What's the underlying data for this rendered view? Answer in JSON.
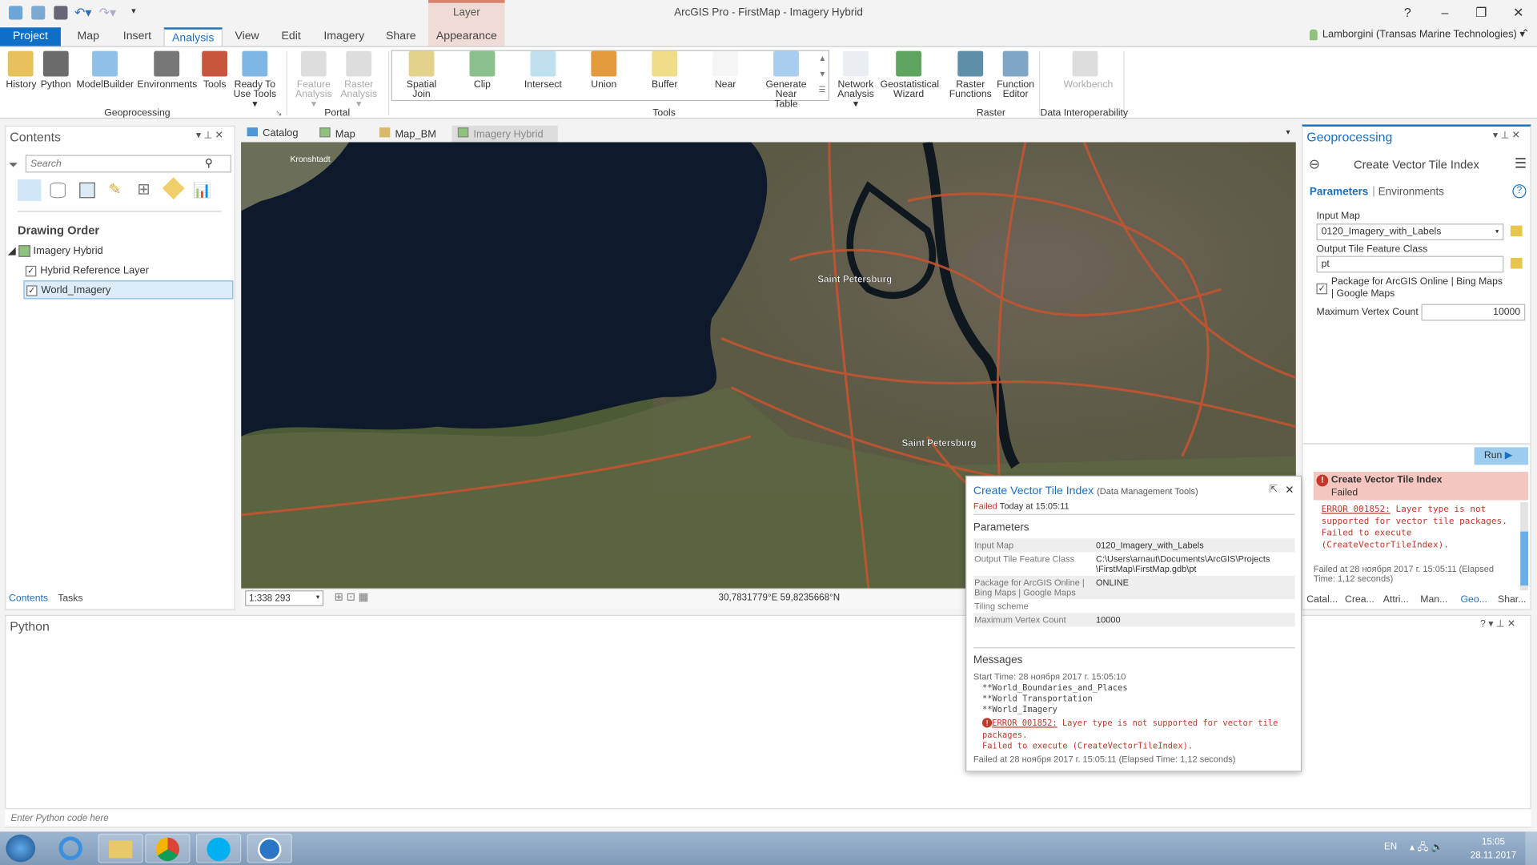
{
  "app": {
    "title": "ArcGIS Pro - FirstMap - Imagery Hybrid",
    "help": "?",
    "contextual_group": "Layer",
    "user": "Lamborgini (Transas Marine Technologies)"
  },
  "tabs": [
    "Project",
    "Map",
    "Insert",
    "Analysis",
    "View",
    "Edit",
    "Imagery",
    "Share",
    "Appearance"
  ],
  "ribbon": {
    "buttons": [
      {
        "label": "History",
        "color": "#e7c15a"
      },
      {
        "label": "Python",
        "color": "#6b6b6b"
      },
      {
        "label": "ModelBuilder",
        "color": "#8fc1e8"
      },
      {
        "label": "Environments",
        "color": "#777"
      },
      {
        "label": "Tools",
        "color": "#c8553d"
      },
      {
        "label": "Ready To\nUse Tools ▾",
        "color": "#7fb6e3"
      },
      {
        "label": "Feature\nAnalysis ▾",
        "color": "#ddd",
        "disabled": true
      },
      {
        "label": "Raster\nAnalysis ▾",
        "color": "#ddd",
        "disabled": true
      },
      {
        "label": "Spatial\nJoin",
        "color": "#e3d38a"
      },
      {
        "label": "Clip",
        "color": "#8bbf8b"
      },
      {
        "label": "Intersect",
        "color": "#bfe0ef"
      },
      {
        "label": "Union",
        "color": "#e39a3d"
      },
      {
        "label": "Buffer",
        "color": "#f0dd8a"
      },
      {
        "label": "Near",
        "color": "#f5f5f5"
      },
      {
        "label": "Generate\nNear Table",
        "color": "#a9cdef"
      },
      {
        "label": "Network\nAnalysis ▾",
        "color": "#e9eef3"
      },
      {
        "label": "Geostatistical\nWizard",
        "color": "#5ea35e"
      },
      {
        "label": "Raster\nFunctions",
        "color": "#5f8fa8"
      },
      {
        "label": "Function\nEditor",
        "color": "#7ea7c5"
      },
      {
        "label": "Workbench",
        "color": "#ddd",
        "disabled": true
      }
    ],
    "groups": [
      "Geoprocessing",
      "Portal",
      "Tools",
      "Raster",
      "Data Interoperability"
    ]
  },
  "contents": {
    "title": "Contents",
    "search_placeholder": "Search",
    "section": "Drawing Order",
    "map": "Imagery Hybrid",
    "layers": [
      {
        "name": "Hybrid Reference Layer",
        "checked": true
      },
      {
        "name": "World_Imagery",
        "checked": true,
        "selected": true
      }
    ],
    "bottom_tabs": [
      "Contents",
      "Tasks"
    ]
  },
  "view_tabs": [
    {
      "label": "Catalog"
    },
    {
      "label": "Map"
    },
    {
      "label": "Map_BM"
    },
    {
      "label": "Imagery Hybrid",
      "active": true
    }
  ],
  "map": {
    "labels": [
      "Kronshtadt",
      "Saint Petersburg",
      "Saint Petersburg"
    ],
    "scale": "1:338 293",
    "coordinates": "30,7831779°E 59,8235668°N"
  },
  "geoprocessing": {
    "title": "Geoprocessing",
    "tool": "Create Vector Tile Index",
    "tab_params": "Parameters",
    "tab_env": "Environments",
    "input_map_label": "Input Map",
    "input_map_value": "0120_Imagery_with_Labels",
    "output_label": "Output Tile Feature Class",
    "output_value": "pt",
    "package_label": "Package for ArcGIS Online | Bing Maps | Google Maps",
    "package_checked": true,
    "vertex_label": "Maximum Vertex Count",
    "vertex_value": "10000",
    "run": "Run",
    "result_title": "Create Vector Tile Index",
    "result_status": "Failed",
    "error_code": "ERROR 001852:",
    "error_text": " Layer type is not supported for vector tile packages.",
    "error_exec": "Failed to execute (CreateVectorTileIndex).",
    "failed_at": "Failed at 28 ноября 2017 г. 15:05:11 (Elapsed Time: 1,12 seconds)",
    "bottom_tabs": [
      "Catal...",
      "Crea...",
      "Attri...",
      "Man...",
      "Geo...",
      "Shar..."
    ]
  },
  "popup": {
    "title": "Create Vector Tile Index",
    "toolbox": "(Data Management Tools)",
    "status": "Failed",
    "when": "Today at 15:05:11",
    "params_title": "Parameters",
    "params": [
      {
        "k": "Input Map",
        "v": "0120_Imagery_with_Labels"
      },
      {
        "k": "Output Tile Feature Class",
        "v": "C:\\Users\\arnaut\\Documents\\ArcGIS\\Projects\n\\FirstMap\\FirstMap.gdb\\pt"
      },
      {
        "k": "Package for ArcGIS Online | Bing Maps | Google Maps",
        "v": "ONLINE"
      },
      {
        "k": "Tiling scheme",
        "v": ""
      },
      {
        "k": "Maximum Vertex Count",
        "v": "10000"
      }
    ],
    "messages_title": "Messages",
    "start": "Start Time: 28 ноября 2017 г. 15:05:10",
    "lines": [
      "**World_Boundaries_and_Places",
      "**World Transportation",
      "**World_Imagery"
    ],
    "error_code": "ERROR 001852:",
    "error_text": " Layer type is not supported for vector tile packages.",
    "error_exec": "Failed to execute (CreateVectorTileIndex).",
    "failed_at": "Failed at 28 ноября 2017 г. 15:05:11 (Elapsed Time: 1,12 seconds)"
  },
  "python": {
    "title": "Python",
    "placeholder": "Enter Python code here"
  },
  "taskbar": {
    "lang": "EN",
    "time": "15:05",
    "date": "28.11.2017"
  }
}
